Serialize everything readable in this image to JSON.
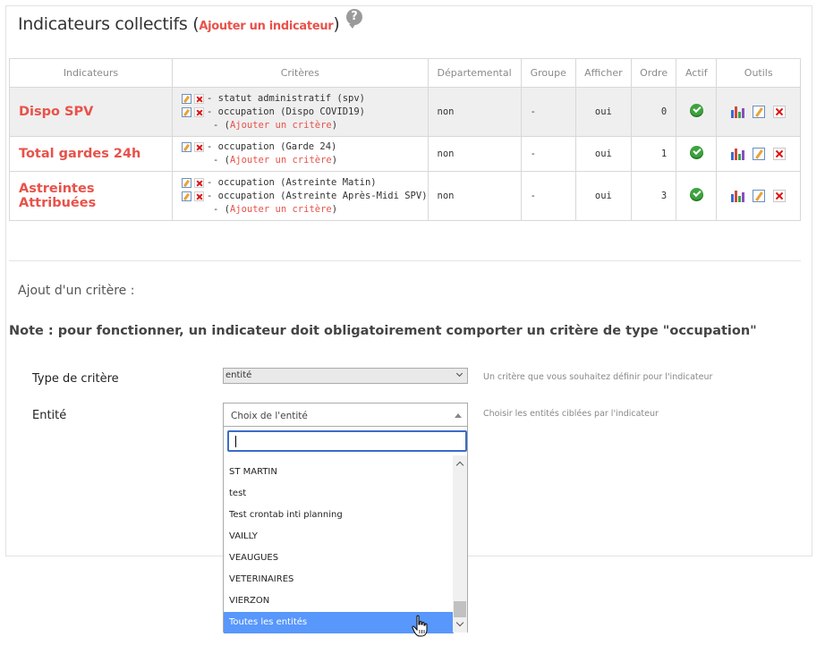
{
  "title": {
    "text": "Indicateurs collectifs (",
    "add_link": "Ajouter un indicateur",
    "close_paren": ")"
  },
  "help": {
    "icon": "help-icon",
    "glyph": "?"
  },
  "table": {
    "headers": [
      "Indicateurs",
      "Critères",
      "Départemental",
      "Groupe",
      "Afficher",
      "Ordre",
      "Actif",
      "Outils"
    ],
    "rows": [
      {
        "name": "Dispo SPV",
        "criteria": [
          "- statut administratif (spv)",
          "- occupation (Dispo COVID19)"
        ],
        "add_criteria": "Ajouter un critère",
        "departemental": "non",
        "groupe": "-",
        "afficher": "oui",
        "ordre": "0"
      },
      {
        "name": "Total gardes 24h",
        "criteria": [
          "- occupation (Garde 24)"
        ],
        "add_criteria": "Ajouter un critère",
        "departemental": "non",
        "groupe": "-",
        "afficher": "oui",
        "ordre": "1"
      },
      {
        "name": "Astreintes Attribuées",
        "criteria": [
          "- occupation (Astreinte Matin)",
          "- occupation (Astreinte Après-Midi SPV)"
        ],
        "add_criteria": "Ajouter un critère",
        "departemental": "non",
        "groupe": "-",
        "afficher": "oui",
        "ordre": "3"
      }
    ],
    "add_prefix": "- (",
    "add_suffix": ")"
  },
  "form": {
    "section_title": "Ajout d'un critère :",
    "note": "Note : pour fonctionner, un indicateur doit obligatoirement comporter un critère de type \"occupation\"",
    "type_label": "Type de critère",
    "type_value": "entité",
    "type_hint": "Un critère que vous souhaitez définir pour l'indicateur",
    "entity_label": "Entité",
    "entity_placeholder": "Choix de l'entité",
    "entity_hint": "Choisir les entités ciblées par l'indicateur",
    "search_value": "",
    "options": [
      "ST MARTIN",
      "test",
      "Test crontab inti planning",
      "VAILLY",
      "VEAUGUES",
      "VETERINAIRES",
      "VIERZON",
      "Toutes les entités"
    ],
    "highlighted_option": "Toutes les entités"
  },
  "colors": {
    "accent": "#e8524a",
    "active_green": "#3ea33e",
    "highlight_blue": "#5897fb",
    "search_border": "#3a6cc8"
  }
}
